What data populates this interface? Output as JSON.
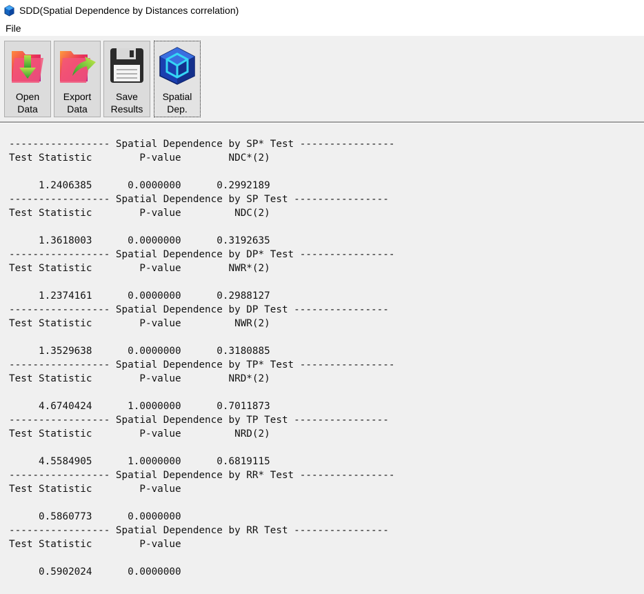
{
  "window": {
    "title": "SDD(Spatial Dependence by Distances correlation)"
  },
  "menu": {
    "items": [
      "File"
    ]
  },
  "toolbar": {
    "buttons": [
      {
        "label": "Open\nData",
        "icon": "open-data-folder-icon"
      },
      {
        "label": "Export\nData",
        "icon": "export-data-folder-icon"
      },
      {
        "label": "Save\nResults",
        "icon": "floppy-disk-icon"
      },
      {
        "label": "Spatial\nDep.",
        "icon": "cube-icon"
      }
    ]
  },
  "output": {
    "text": "----------------- Spatial Dependence by SP* Test ----------------\nTest Statistic        P-value        NDC*(2)\n\n     1.2406385      0.0000000      0.2992189\n----------------- Spatial Dependence by SP Test ----------------\nTest Statistic        P-value         NDC(2)\n\n     1.3618003      0.0000000      0.3192635\n----------------- Spatial Dependence by DP* Test ----------------\nTest Statistic        P-value        NWR*(2)\n\n     1.2374161      0.0000000      0.2988127\n----------------- Spatial Dependence by DP Test ----------------\nTest Statistic        P-value         NWR(2)\n\n     1.3529638      0.0000000      0.3180885\n----------------- Spatial Dependence by TP* Test ----------------\nTest Statistic        P-value        NRD*(2)\n\n     4.6740424      1.0000000      0.7011873\n----------------- Spatial Dependence by TP Test ----------------\nTest Statistic        P-value         NRD(2)\n\n     4.5584905      1.0000000      0.6819115\n----------------- Spatial Dependence by RR* Test ----------------\nTest Statistic        P-value\n\n     0.5860773      0.0000000\n----------------- Spatial Dependence by RR Test ----------------\nTest Statistic        P-value\n\n     0.5902024      0.0000000"
  },
  "colors": {
    "toolbar_bg": "#f0f0f0",
    "button_bg": "#dcdcdc",
    "output_bg": "#f0f0f0"
  }
}
